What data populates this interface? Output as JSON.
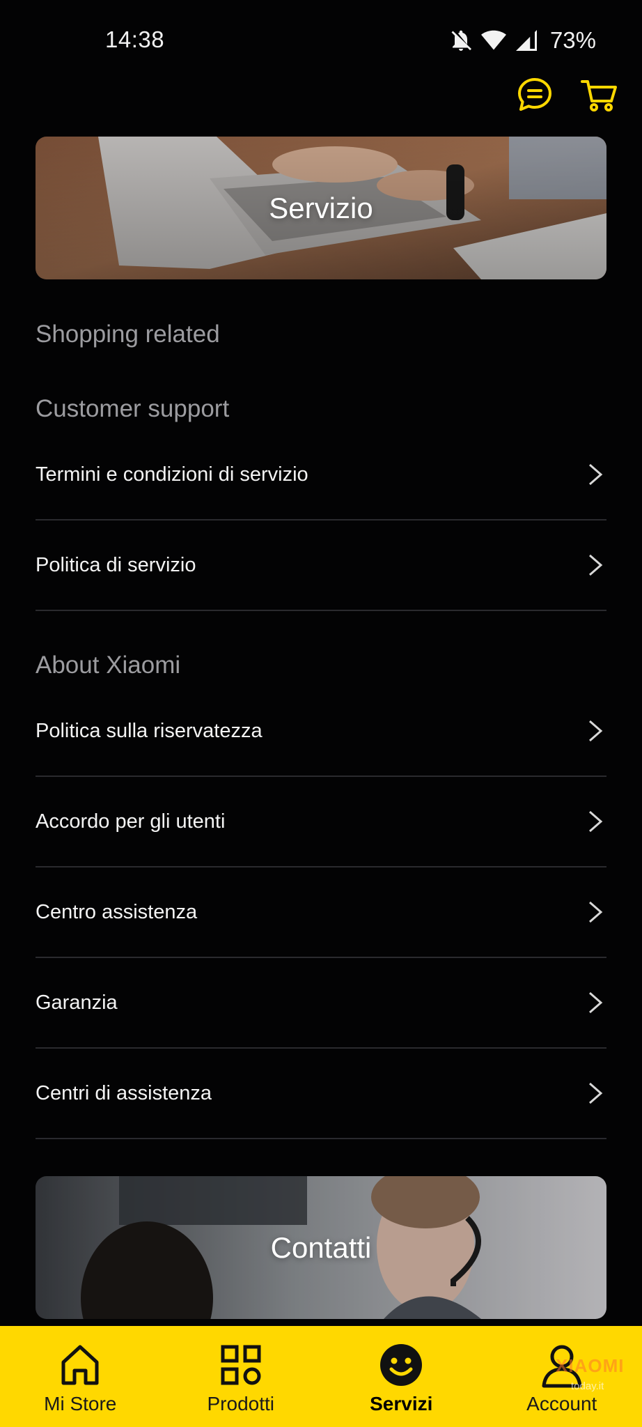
{
  "status_bar": {
    "time": "14:38",
    "battery": "73%",
    "icons": [
      "bell-off-icon",
      "wifi-icon",
      "cellular-signal-icon"
    ]
  },
  "header": {
    "icons": [
      "chat-icon",
      "cart-icon"
    ],
    "accent_color": "#ffd800"
  },
  "banners": {
    "servizio_label": "Servizio",
    "contatti_label": "Contatti"
  },
  "sections": {
    "shopping_related": "Shopping related",
    "customer_support": "Customer support",
    "about_xiaomi": "About Xiaomi"
  },
  "customer_support_items": [
    {
      "label": "Termini e condizioni di servizio"
    },
    {
      "label": "Politica di servizio"
    }
  ],
  "about_items": [
    {
      "label": "Politica sulla riservatezza"
    },
    {
      "label": "Accordo per gli utenti"
    },
    {
      "label": "Centro assistenza"
    },
    {
      "label": "Garanzia"
    },
    {
      "label": "Centri di assistenza"
    }
  ],
  "bottom_nav": {
    "background": "#ffd800",
    "items": [
      {
        "label": "Mi Store",
        "icon": "home-icon"
      },
      {
        "label": "Prodotti",
        "icon": "grid-icon"
      },
      {
        "label": "Servizi",
        "icon": "smiley-icon",
        "active": true
      },
      {
        "label": "Account",
        "icon": "user-icon"
      }
    ]
  },
  "watermark": {
    "brand": "XIAOMI",
    "site": "today.it"
  }
}
